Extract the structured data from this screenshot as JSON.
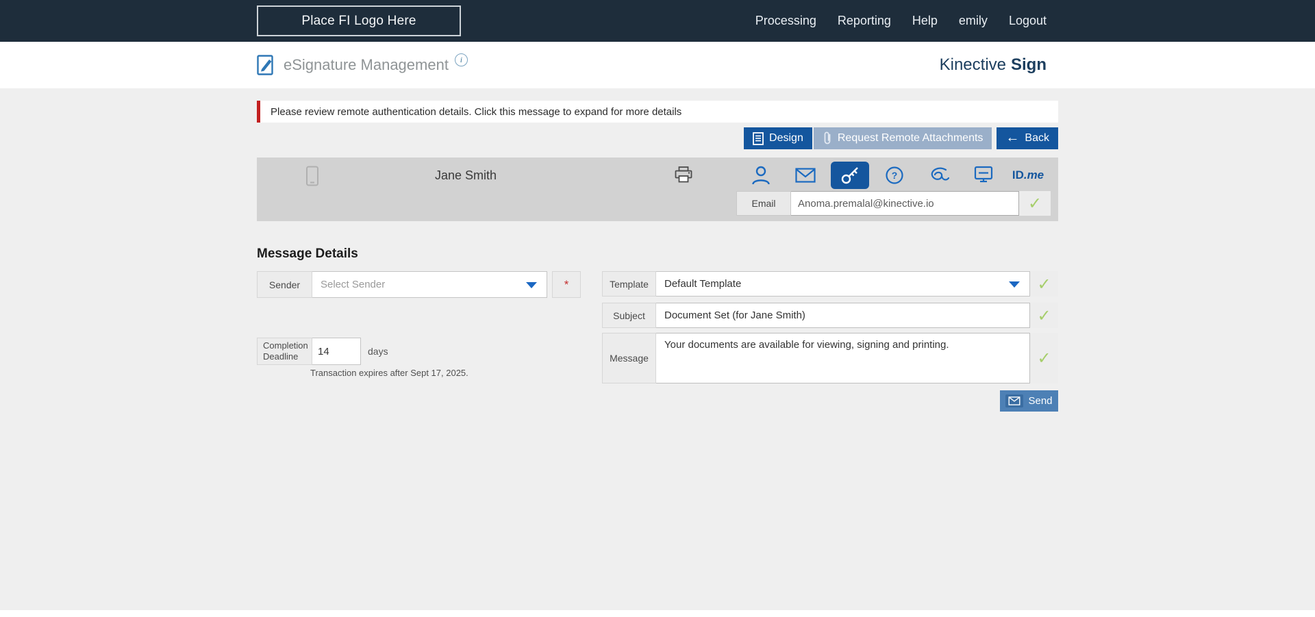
{
  "topbar": {
    "logo_text": "Place FI Logo Here",
    "nav": [
      {
        "label": "Processing"
      },
      {
        "label": "Reporting"
      },
      {
        "label": "Help"
      },
      {
        "label": "emily"
      },
      {
        "label": "Logout"
      }
    ]
  },
  "header": {
    "title": "eSignature Management",
    "brand_name": "Kinective",
    "brand_suffix": "Sign"
  },
  "alert": {
    "text": "Please review remote authentication details. Click this message to expand for more details"
  },
  "toolbar": {
    "design_label": "Design",
    "request_label": "Request Remote Attachments",
    "back_label": "Back"
  },
  "recipient": {
    "name": "Jane Smith",
    "email_label": "Email",
    "email_value": "Anoma.premalal@kinective.io",
    "idme_id": "ID",
    "idme_me": ".me",
    "auth_methods": [
      "user",
      "email",
      "password-key",
      "kba-question",
      "signature",
      "in-person-kiosk",
      "idme"
    ],
    "selected_auth": "password-key"
  },
  "message_details": {
    "heading": "Message Details",
    "sender": {
      "label": "Sender",
      "placeholder": "Select Sender"
    },
    "completion": {
      "label": "Completion Deadline",
      "value": "14",
      "unit": "days",
      "note": "Transaction expires after Sept 17, 2025."
    },
    "template": {
      "label": "Template",
      "value": "Default Template"
    },
    "subject": {
      "label": "Subject",
      "value": "Document Set (for Jane Smith)"
    },
    "message": {
      "label": "Message",
      "value": "Your documents are available for viewing, signing and printing."
    },
    "send_label": "Send"
  },
  "glyphs": {
    "check": "✓",
    "back_arrow": "←",
    "required": "*",
    "info": "i"
  },
  "colors": {
    "topbar_bg": "#1e2d3b",
    "primary_blue": "#14569e",
    "light_blue_button": "#9aafc9",
    "brand_navy": "#1c3e5e",
    "alert_red": "#c21f1f",
    "check_green": "#a6ce6b",
    "page_bg": "#efefef",
    "recipient_bg": "#d2d2d2",
    "icon_blue": "#1b6ac0",
    "send_blue": "#4d80b5"
  }
}
